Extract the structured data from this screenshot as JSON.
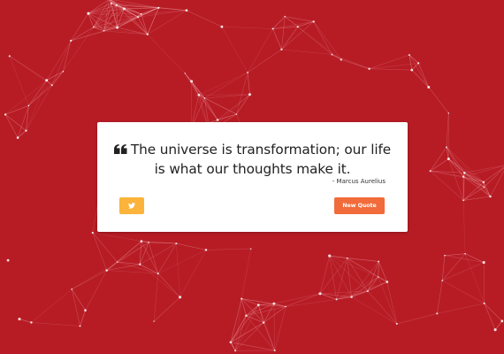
{
  "colors": {
    "background": "#b71c25",
    "network_line": "#f4a6ab",
    "network_dot": "#ffffff",
    "card": "#ffffff",
    "quote_text": "#222222",
    "tweet_button": "#fbb33b",
    "new_quote_button": "#f26b3a"
  },
  "quote": {
    "icon": "quote-left-icon",
    "text": "The universe is transformation; our life is what our thoughts make it.",
    "author": "- Marcus Aurelius"
  },
  "actions": {
    "tweet_icon": "twitter-bird-icon",
    "new_quote_label": "New Quote"
  }
}
